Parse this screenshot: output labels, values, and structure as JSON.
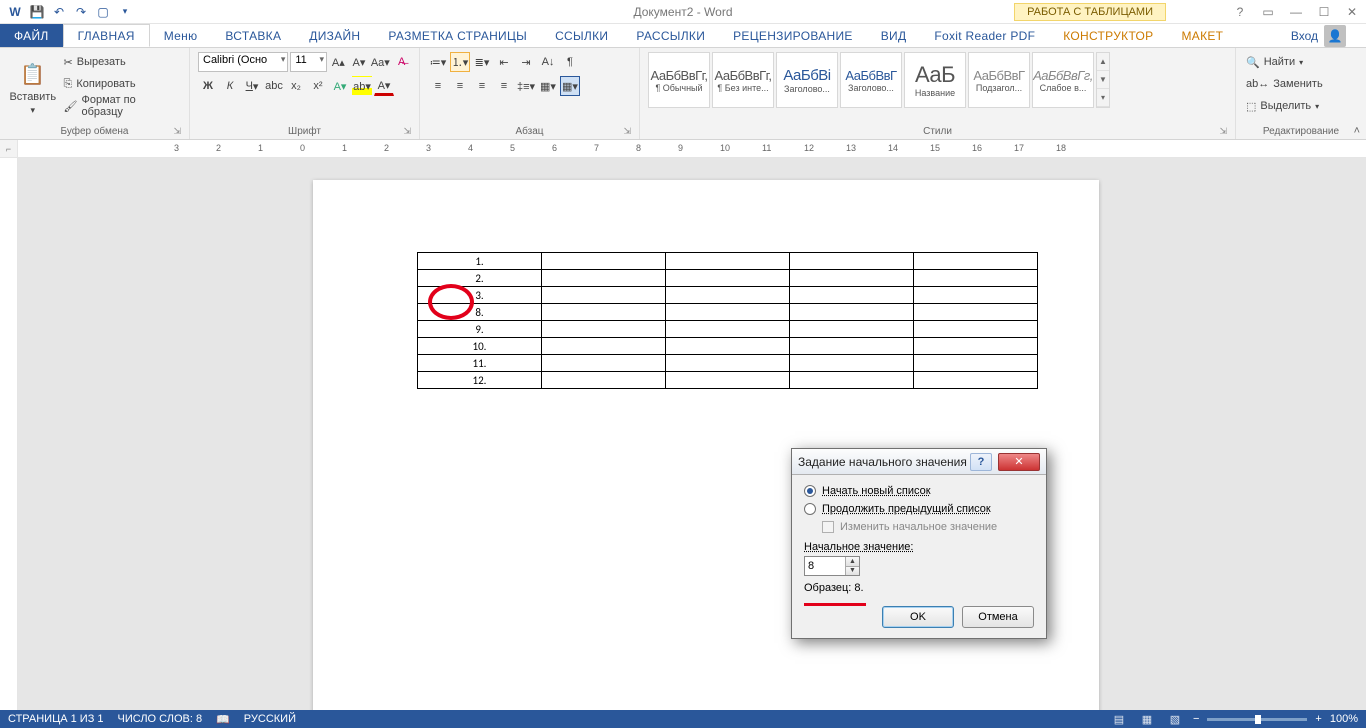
{
  "titlebar": {
    "doc_title": "Документ2 - Word",
    "table_tools": "РАБОТА С ТАБЛИЦАМИ"
  },
  "tabs": {
    "file": "ФАЙЛ",
    "home": "ГЛАВНАЯ",
    "menu": "Меню",
    "insert": "ВСТАВКА",
    "design": "ДИЗАЙН",
    "layout": "РАЗМЕТКА СТРАНИЦЫ",
    "references": "ССЫЛКИ",
    "mailings": "РАССЫЛКИ",
    "review": "РЕЦЕНЗИРОВАНИЕ",
    "view": "ВИД",
    "foxit": "Foxit Reader PDF",
    "constructor": "КОНСТРУКТОР",
    "table_layout": "МАКЕТ",
    "signin": "Вход"
  },
  "ribbon": {
    "clipboard": {
      "paste": "Вставить",
      "cut": "Вырезать",
      "copy": "Копировать",
      "format_painter": "Формат по образцу",
      "group": "Буфер обмена"
    },
    "font": {
      "name": "Calibri (Осно",
      "size": "11",
      "group": "Шрифт"
    },
    "paragraph": {
      "group": "Абзац"
    },
    "styles": {
      "items": [
        {
          "preview": "АаБбВвГг,",
          "name": "¶ Обычный"
        },
        {
          "preview": "АаБбВвГг,",
          "name": "¶ Без инте..."
        },
        {
          "preview": "АаБбВі",
          "name": "Заголово..."
        },
        {
          "preview": "АаБбВвГ",
          "name": "Заголово..."
        },
        {
          "preview": "АаБ",
          "name": "Название"
        },
        {
          "preview": "АаБбВвГ",
          "name": "Подзагол..."
        },
        {
          "preview": "АаБбВвГг,",
          "name": "Слабое в..."
        }
      ],
      "group": "Стили"
    },
    "editing": {
      "find": "Найти",
      "replace": "Заменить",
      "select": "Выделить",
      "group": "Редактирование"
    }
  },
  "document": {
    "list_numbers": [
      "1.",
      "2.",
      "3.",
      "8.",
      "9.",
      "10.",
      "11.",
      "12."
    ]
  },
  "dialog": {
    "title": "Задание начального значения",
    "opt_new": "Начать новый список",
    "opt_continue": "Продолжить предыдущий список",
    "chk_change": "Изменить начальное значение",
    "label_start": "Начальное значение:",
    "value": "8",
    "preview_label": "Образец: 8.",
    "ok": "OK",
    "cancel": "Отмена"
  },
  "statusbar": {
    "page": "СТРАНИЦА 1 ИЗ 1",
    "words": "ЧИСЛО СЛОВ: 8",
    "lang": "РУССКИЙ",
    "zoom": "100%"
  }
}
